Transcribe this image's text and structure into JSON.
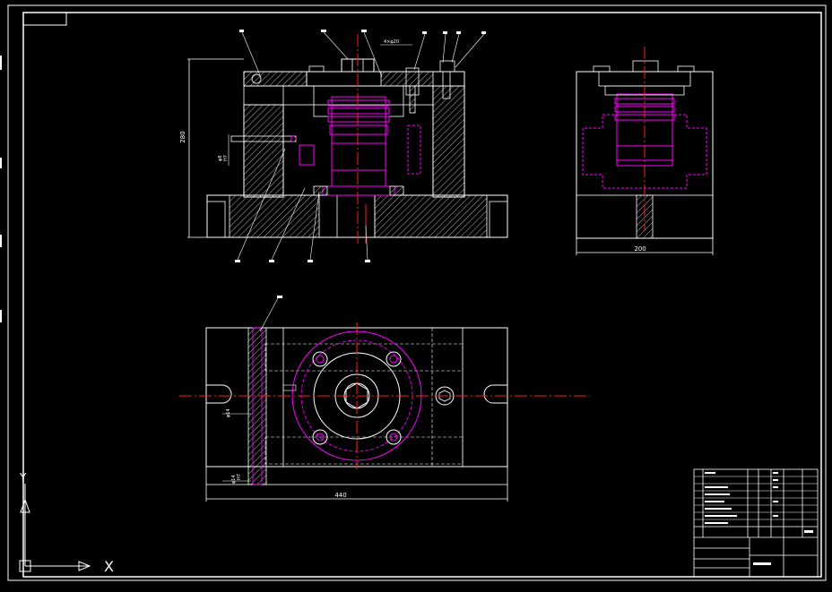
{
  "application": "CAD drawing viewer",
  "colors": {
    "background": "#000000",
    "outline": "#ffffff",
    "hidden_line": "#ff00ff",
    "center_line": "#ff2020",
    "hatch": "#ffffff",
    "ucs_icon": "#ffffff"
  },
  "front_view": {
    "height_dimension": "280",
    "left_callout_a": "φ8",
    "left_callout_b": "H7",
    "left_callout_c": "φ8",
    "top_callout": "4×φ20"
  },
  "side_view": {
    "width_dimension": "200"
  },
  "plan_view": {
    "length_dimension": "440",
    "left_callout_upper": "φ14",
    "left_callout_lower": "φ14",
    "left_callout_lower_fit": "H7"
  },
  "ucs_icon": {
    "x_label": "X",
    "y_label": "Y"
  },
  "title_block": {
    "present": true
  }
}
